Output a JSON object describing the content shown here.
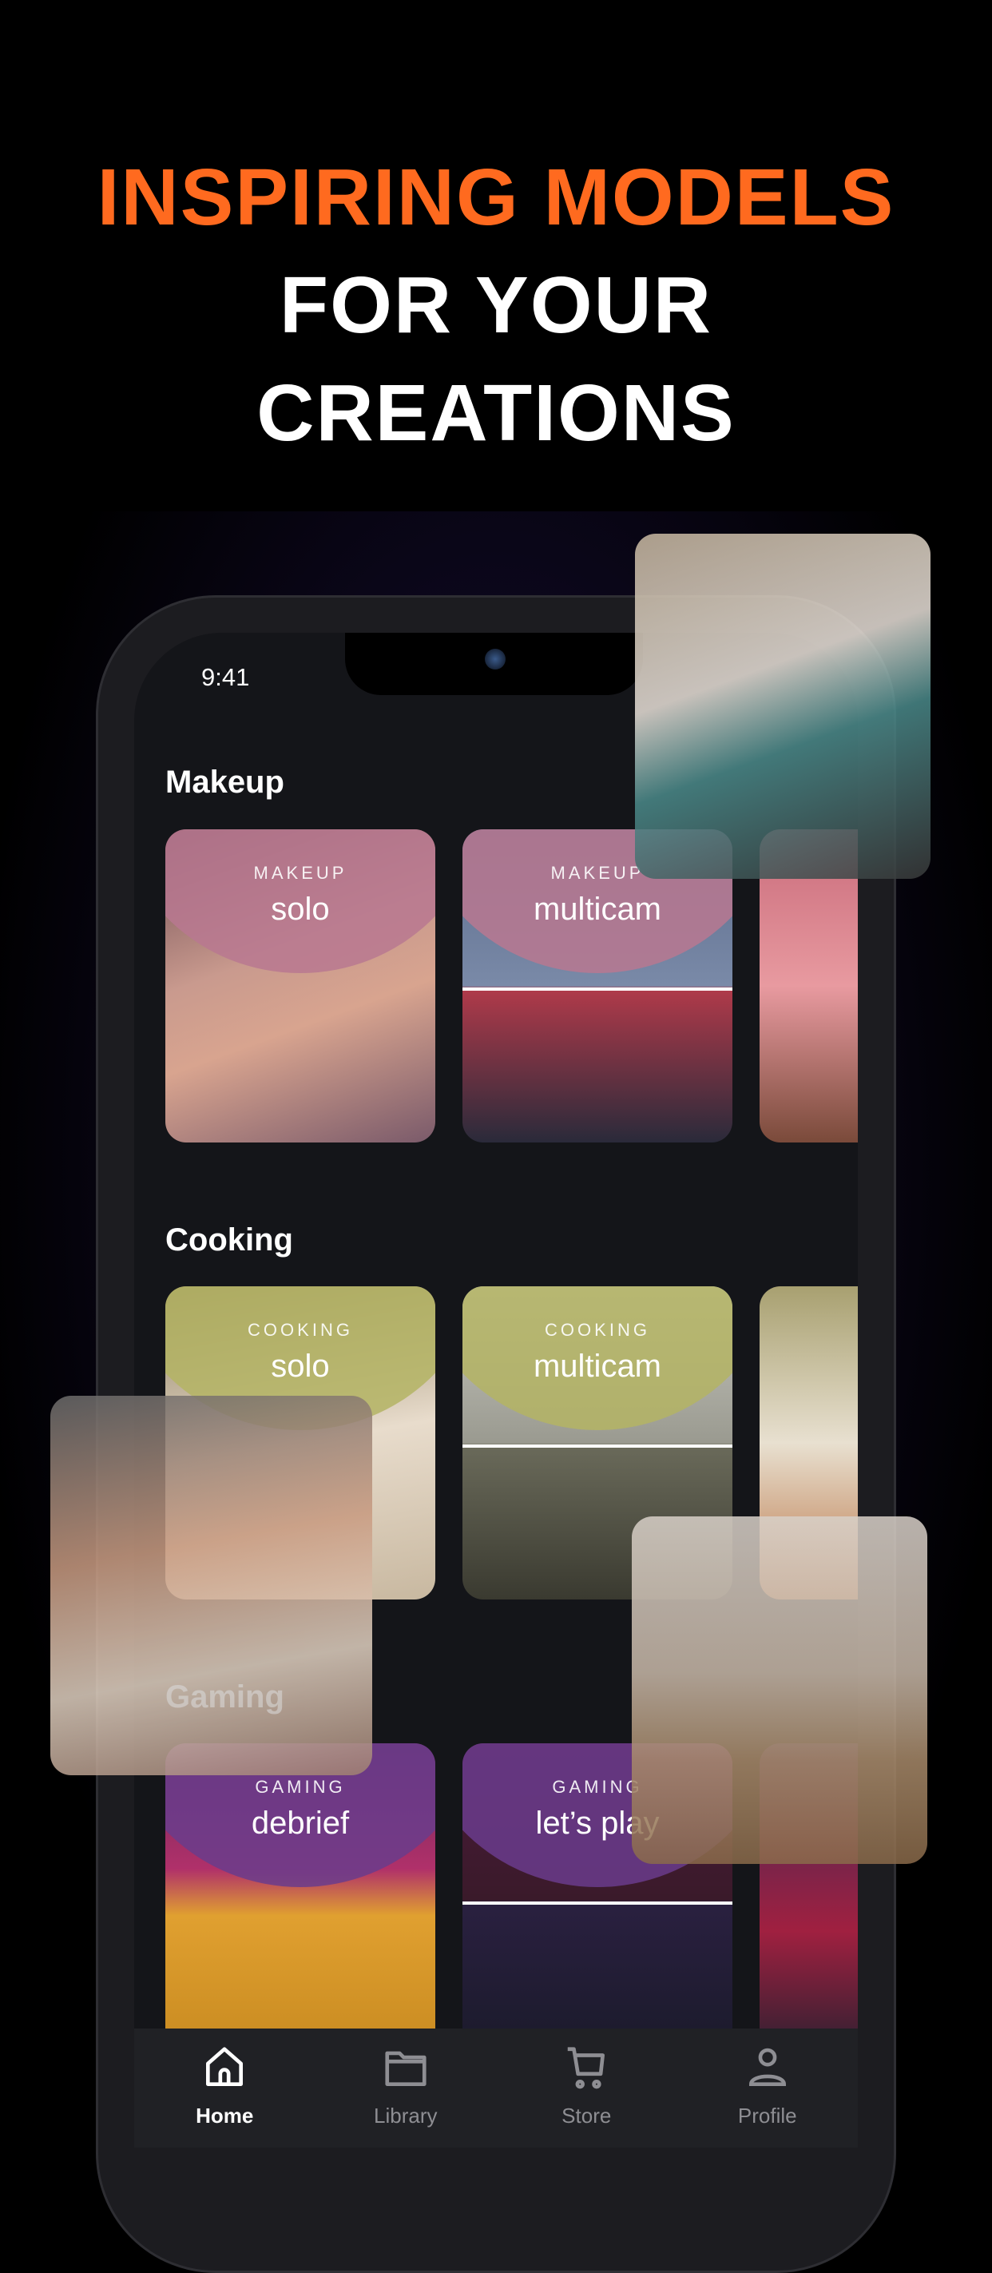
{
  "headline": {
    "line1": "INSPIRING MODELS",
    "line2": "FOR YOUR",
    "line3": "CREATIONS"
  },
  "colors": {
    "accent": "#ff6a1f",
    "makeup": "#b87890",
    "cooking": "#b4b464",
    "gaming": "#6a3c8c"
  },
  "status": {
    "time": "9:41"
  },
  "sections": [
    {
      "title": "Makeup",
      "cards": [
        {
          "category": "MAKEUP",
          "title": "solo"
        },
        {
          "category": "MAKEUP",
          "title": "multicam"
        }
      ]
    },
    {
      "title": "Cooking",
      "cards": [
        {
          "category": "COOKING",
          "title": "solo"
        },
        {
          "category": "COOKING",
          "title": "multicam"
        }
      ]
    },
    {
      "title": "Gaming",
      "cards": [
        {
          "category": "GAMING",
          "title": "debrief"
        },
        {
          "category": "GAMING",
          "title": "let’s play"
        }
      ]
    }
  ],
  "nav": [
    {
      "label": "Home",
      "icon": "home-icon",
      "active": true
    },
    {
      "label": "Library",
      "icon": "folder-icon"
    },
    {
      "label": "Store",
      "icon": "cart-icon"
    },
    {
      "label": "Profile",
      "icon": "person-icon"
    }
  ]
}
